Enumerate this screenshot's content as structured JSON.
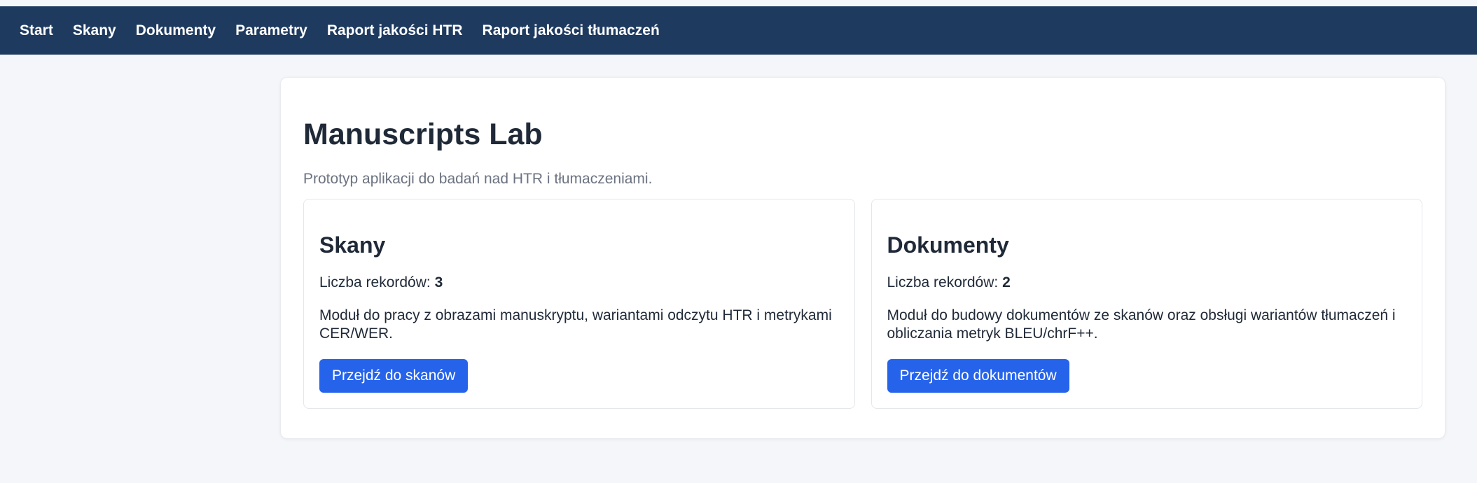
{
  "nav": {
    "items": [
      {
        "label": "Start"
      },
      {
        "label": "Skany"
      },
      {
        "label": "Dokumenty"
      },
      {
        "label": "Parametry"
      },
      {
        "label": "Raport jakości HTR"
      },
      {
        "label": "Raport jakości tłumaczeń"
      }
    ]
  },
  "main": {
    "title": "Manuscripts Lab",
    "subtitle": "Prototyp aplikacji do badań nad HTR i tłumaczeniami.",
    "cards": [
      {
        "title": "Skany",
        "count_label": "Liczba rekordów:",
        "count_value": "3",
        "description": "Moduł do pracy z obrazami manuskryptu, wariantami odczytu HTR i metrykami CER/WER.",
        "button_label": "Przejdź do skanów"
      },
      {
        "title": "Dokumenty",
        "count_label": "Liczba rekordów:",
        "count_value": "2",
        "description": "Moduł do budowy dokumentów ze skanów oraz obsługi wariantów tłumaczeń i obliczania metryk BLEU/chrF++.",
        "button_label": "Przejdź do dokumentów"
      }
    ]
  },
  "colors": {
    "navbar": "#1e3a5f",
    "primary_button": "#2563eb",
    "background": "#f4f6fa"
  }
}
